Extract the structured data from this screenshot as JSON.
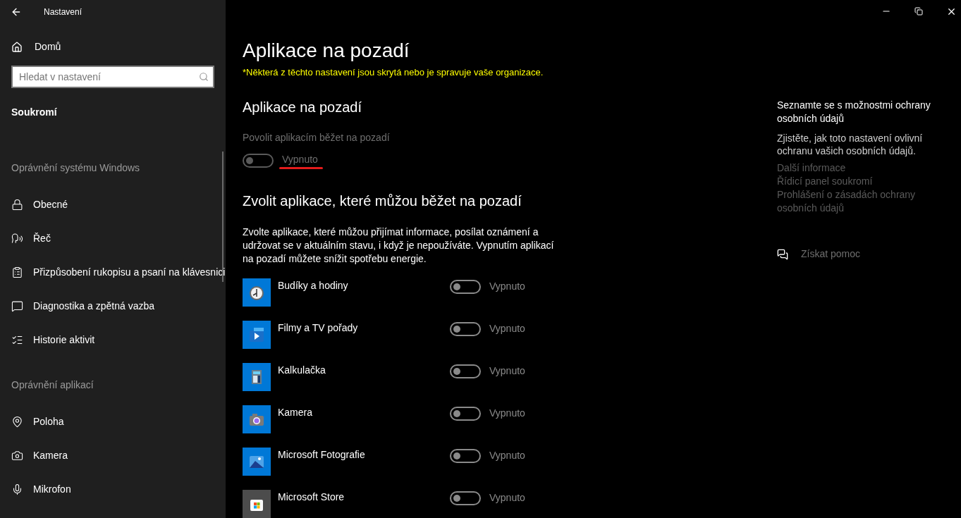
{
  "window": {
    "title": "Nastavení"
  },
  "sidebar": {
    "home": "Domů",
    "search": {
      "placeholder": "Hledat v nastavení"
    },
    "category": "Soukromí",
    "groups": [
      {
        "heading": "Oprávnění systému Windows",
        "items": [
          {
            "label": "Obecné",
            "selected": false
          },
          {
            "label": "Řeč",
            "selected": false
          },
          {
            "label": "Přizpůsobení rukopisu a psaní na klávesnici",
            "selected": false
          },
          {
            "label": "Diagnostika a zpětná vazba",
            "selected": false
          },
          {
            "label": "Historie aktivit",
            "selected": false
          }
        ]
      },
      {
        "heading": "Oprávnění aplikací",
        "items": [
          {
            "label": "Poloha",
            "selected": false
          },
          {
            "label": "Kamera",
            "selected": false
          },
          {
            "label": "Mikrofon",
            "selected": false
          }
        ]
      }
    ]
  },
  "main": {
    "title": "Aplikace na pozadí",
    "notice": "*Některá z těchto nastavení jsou skrytá nebo je spravuje vaše organizace.",
    "section1": {
      "heading": "Aplikace na pozadí",
      "label": "Povolit aplikacím běžet na pozadí",
      "toggle": {
        "on": false,
        "disabled": true,
        "state": "Vypnuto"
      }
    },
    "section2": {
      "heading": "Zvolit aplikace, které můžou běžet na pozadí",
      "description": "Zvolte aplikace, které můžou přijímat informace, posílat oznámení a udržovat se v aktuálním stavu, i když je nepoužíváte. Vypnutím aplikací na pozadí můžete snížit spotřebu energie.",
      "apps": [
        {
          "name": "Budíky a hodiny",
          "on": false,
          "state": "Vypnuto"
        },
        {
          "name": "Filmy a TV pořady",
          "on": false,
          "state": "Vypnuto"
        },
        {
          "name": "Kalkulačka",
          "on": false,
          "state": "Vypnuto"
        },
        {
          "name": "Kamera",
          "on": false,
          "state": "Vypnuto"
        },
        {
          "name": "Microsoft Fotografie",
          "on": false,
          "state": "Vypnuto"
        },
        {
          "name": "Microsoft Store",
          "on": false,
          "state": "Vypnuto"
        }
      ]
    }
  },
  "aside": {
    "heading": "Seznamte se s možnostmi ochrany osobních údajů",
    "text": "Zjistěte, jak toto nastavení ovlivní ochranu vašich osobních údajů.",
    "links": [
      "Další informace",
      "Řídicí panel soukromí",
      "Prohlášení o zásadách ochrany osobních údajů"
    ],
    "help": "Získat pomoc"
  }
}
